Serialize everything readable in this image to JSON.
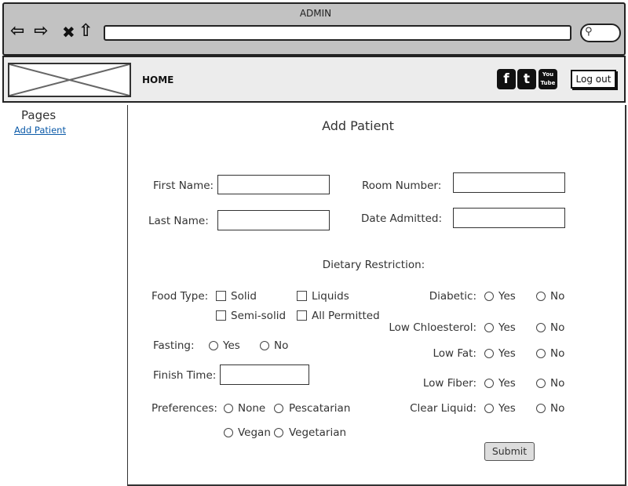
{
  "browser": {
    "title": "ADMIN",
    "url": ""
  },
  "nav": {
    "home": "HOME",
    "social": [
      "f",
      "t",
      "You Tube"
    ],
    "logout": "Log out"
  },
  "sidebar": {
    "heading": "Pages",
    "link": "Add Patient"
  },
  "form": {
    "title": "Add Patient",
    "first_name": "First Name:",
    "last_name": "Last Name:",
    "room_number": "Room Number:",
    "date_admitted": "Date Admitted:",
    "dietary": "Dietary Restriction:",
    "food_type": "Food Type:",
    "food_options": [
      "Solid",
      "Liquids",
      "Semi-solid",
      "All Permitted"
    ],
    "fasting": "Fasting:",
    "yes": "Yes",
    "no": "No",
    "finish_time": "Finish Time:",
    "preferences": "Preferences:",
    "pref_options": [
      "None",
      "Pescatarian",
      "Vegan",
      "Vegetarian"
    ],
    "right": [
      "Diabetic:",
      "Low Chloesterol:",
      "Low Fat:",
      "Low Fiber:",
      "Clear Liquid:"
    ],
    "submit": "Submit"
  }
}
